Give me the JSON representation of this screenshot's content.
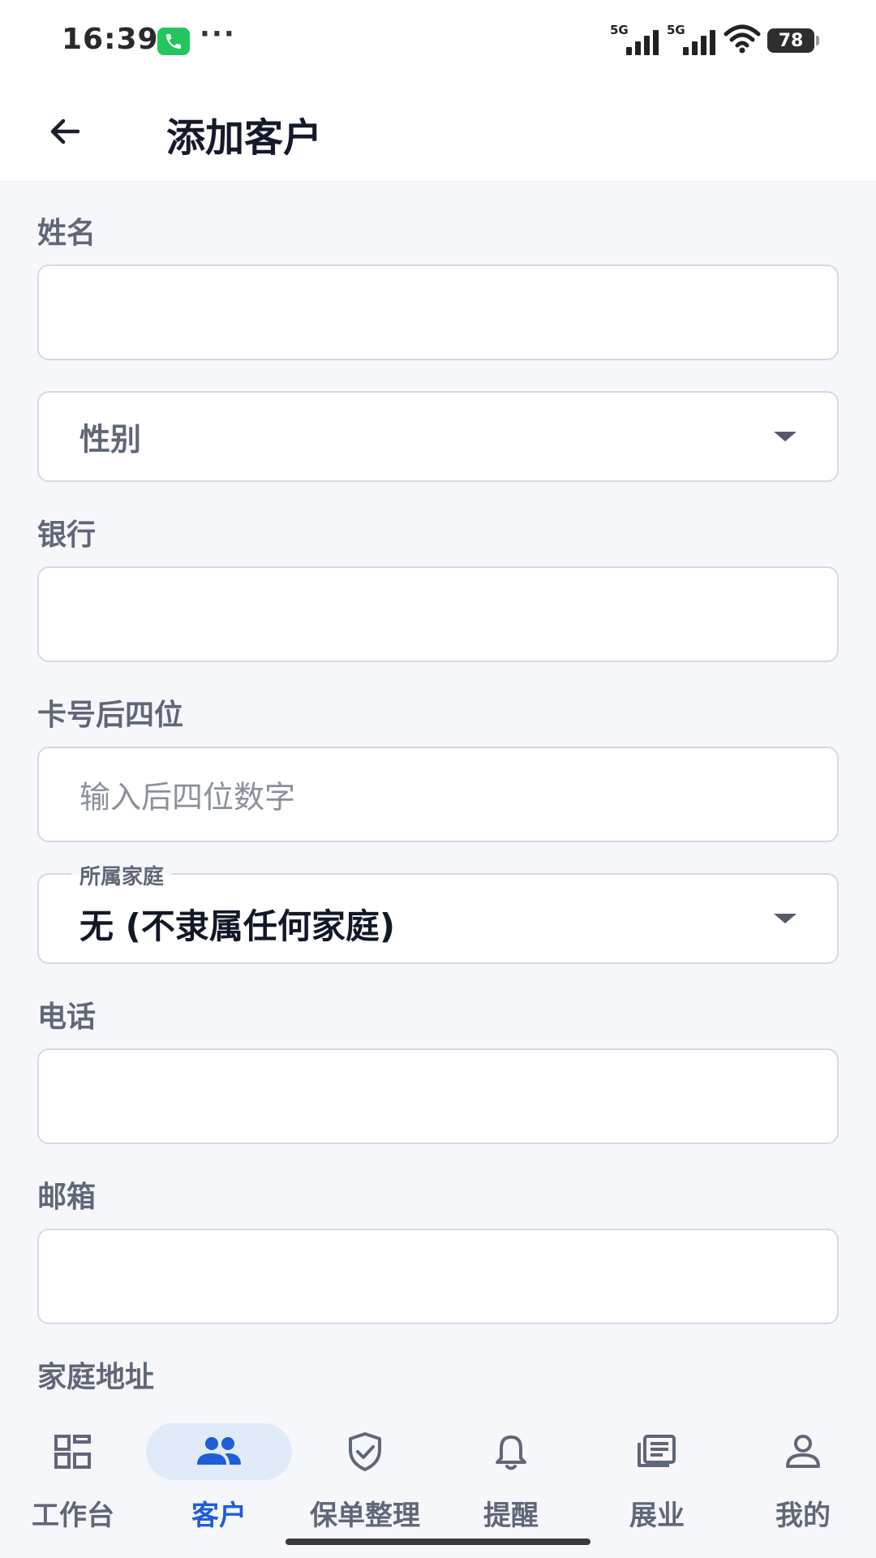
{
  "status_bar": {
    "time": "16:39",
    "dots": "···",
    "network_1": "5G",
    "network_2": "5G",
    "battery": "78"
  },
  "app_bar": {
    "title": "添加客户"
  },
  "form": {
    "name_label": "姓名",
    "gender_placeholder": "性别",
    "bank_label": "银行",
    "card_label": "卡号后四位",
    "card_placeholder": "输入后四位数字",
    "family_label": "所属家庭",
    "family_value": "无 (不隶属任何家庭)",
    "phone_label": "电话",
    "email_label": "邮箱",
    "address_label": "家庭地址"
  },
  "bottom_nav": {
    "items": [
      {
        "label": "工作台",
        "icon": "dashboard-icon"
      },
      {
        "label": "客户",
        "icon": "people-icon"
      },
      {
        "label": "保单整理",
        "icon": "shield-check-icon"
      },
      {
        "label": "提醒",
        "icon": "bell-icon"
      },
      {
        "label": "展业",
        "icon": "news-icon"
      },
      {
        "label": "我的",
        "icon": "person-icon"
      }
    ],
    "active_index": 1
  },
  "colors": {
    "accent": "#1d5ed8",
    "active_pill": "#e1eaf9",
    "background": "#f5f7fb"
  }
}
